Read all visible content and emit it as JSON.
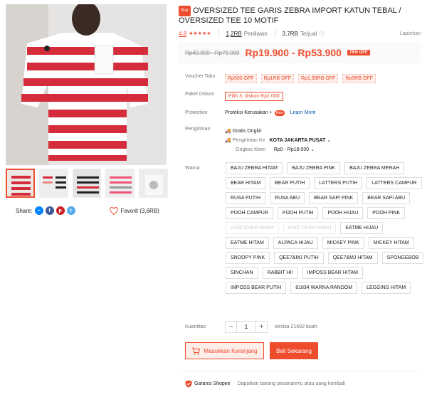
{
  "product": {
    "badge": "Star",
    "title": "OVERSIZED TEE GARIS ZEBRA IMPORT KATUN TEBAL / OVERSIZED TEE 10 MOTIF",
    "rating": "4.8",
    "reviews_count": "1,2RB",
    "reviews_label": "Penilaian",
    "sold_count": "3,7RB",
    "sold_label": "Terjual",
    "report": "Laporkan",
    "old_price": "Rp49.900 - Rp79.900",
    "price": "Rp19.900 - Rp53.900",
    "discount": "75% OFF"
  },
  "voucher": {
    "label": "Voucher Toko",
    "items": [
      "Rp500 OFF",
      "Rp1RB OFF",
      "Rp1,99RB OFF",
      "Rp5RB OFF"
    ]
  },
  "bundle": {
    "label": "Paket Diskon",
    "value": "Pilih 3, diskon Rp1.000"
  },
  "protection": {
    "label": "Protection",
    "value": "Proteksi Kerusakan +",
    "new": "New",
    "link": "Learn More"
  },
  "shipping": {
    "label": "Pengiriman",
    "free": "Gratis Ongkir",
    "to_label": "Pengiriman Ke",
    "to_value": "KOTA JAKARTA PUSAT",
    "cost_label": "Ongkos Kirim",
    "cost_value": "Rp0 - Rp18.000"
  },
  "variants": {
    "label": "Warna",
    "items": [
      {
        "name": "BAJU ZEBRA HITAM",
        "disabled": false
      },
      {
        "name": "BAJU ZEBRA PINK",
        "disabled": false
      },
      {
        "name": "BAJU ZEBRA MERAH",
        "disabled": false
      },
      {
        "name": "BEAR HITAM",
        "disabled": false
      },
      {
        "name": "BEAR PUTIH",
        "disabled": false
      },
      {
        "name": "LATTERS PUTIH",
        "disabled": false
      },
      {
        "name": "LATTERS CAMPUR",
        "disabled": false
      },
      {
        "name": "RUSA PUTIH",
        "disabled": false
      },
      {
        "name": "RUSA ABU",
        "disabled": false
      },
      {
        "name": "BEAR SAPI PINK",
        "disabled": false
      },
      {
        "name": "BEAR SAPI ABU",
        "disabled": false
      },
      {
        "name": "POOH CAMPUR",
        "disabled": false
      },
      {
        "name": "POOH PUTIH",
        "disabled": false
      },
      {
        "name": "POOH HIJAU",
        "disabled": false
      },
      {
        "name": "POOH PINK",
        "disabled": false
      },
      {
        "name": "GIVE OVER KREM",
        "disabled": true
      },
      {
        "name": "GIVE OVER HIJAU",
        "disabled": true
      },
      {
        "name": "EATME HIJAU",
        "disabled": false
      },
      {
        "name": "EATME HITAM",
        "disabled": false
      },
      {
        "name": "ALPACA HIJAU",
        "disabled": false
      },
      {
        "name": "MICKEY PINK",
        "disabled": false
      },
      {
        "name": "MICKEY HITAM",
        "disabled": false
      },
      {
        "name": "SNOOPY PINK",
        "disabled": false
      },
      {
        "name": "QEE7&MJ PUTIH",
        "disabled": false
      },
      {
        "name": "QEE7&MJ HITAM",
        "disabled": false
      },
      {
        "name": "SPONGEBOB",
        "disabled": false
      },
      {
        "name": "SINCHAN",
        "disabled": false
      },
      {
        "name": "RABBIT HI!",
        "disabled": false
      },
      {
        "name": "IMPOSS BEAR HITAM",
        "disabled": false
      },
      {
        "name": "IMPOSS BEAR PUTIH",
        "disabled": false
      },
      {
        "name": "81834 WARNA RANDOM",
        "disabled": false
      },
      {
        "name": "LEGGING HITAM",
        "disabled": false
      }
    ]
  },
  "quantity": {
    "label": "Kuantitas",
    "value": "1",
    "minus": "−",
    "plus": "+",
    "stock": "tersisa 21692 buah"
  },
  "actions": {
    "cart": "Masukkan Keranjang",
    "buy": "Beli Sekarang"
  },
  "guarantee": {
    "title": "Garansi Shopee",
    "desc": "Dapatkan barang pesananmu atau uang kembali"
  },
  "share": {
    "label": "Share:",
    "favorite": "Favorit (3,6RB)"
  },
  "colors": {
    "accent": "#ee4d2d",
    "messenger": "#0084ff",
    "facebook": "#3b5998",
    "pinterest": "#cb2027",
    "twitter": "#55acee"
  }
}
